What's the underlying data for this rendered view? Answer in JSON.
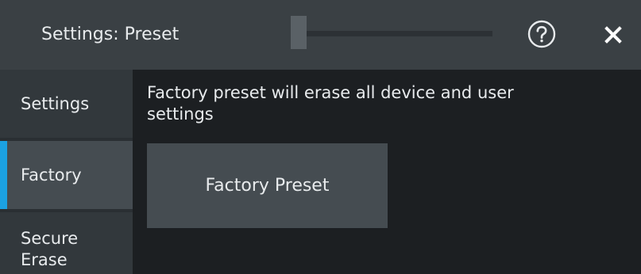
{
  "window": {
    "title": "Settings: Preset",
    "help_icon": "question-circle-icon",
    "close_icon": "close-icon"
  },
  "sidebar": {
    "items": [
      {
        "label": "Settings",
        "active": false
      },
      {
        "label": "Factory",
        "active": true
      },
      {
        "label": "Secure Erase",
        "active": false
      }
    ]
  },
  "main": {
    "description": "Factory preset will erase all device and user settings",
    "preset_button_label": "Factory Preset"
  },
  "colors": {
    "accent": "#1ba1e2",
    "titlebar": "#3a4044",
    "background": "#1c1f22",
    "button": "#454c51"
  }
}
